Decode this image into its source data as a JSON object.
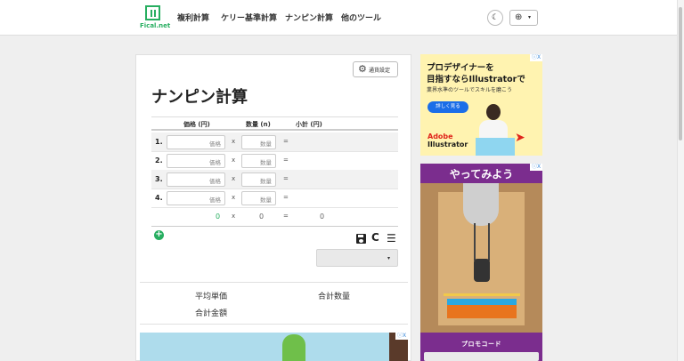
{
  "nav": {
    "logo_text": "Fical.net",
    "links": [
      "複利計算",
      "ケリー基準計算",
      "ナンピン計算",
      "他のツール"
    ],
    "theme_icon": "moon-icon",
    "lang_icon": "globe-icon",
    "lang_caret": "▾"
  },
  "card": {
    "settings_label": "通貨設定",
    "title": "ナンピン計算",
    "headers": {
      "price": "価格 (円)",
      "qty": "数量 (n)",
      "subtotal": "小計 (円)"
    },
    "rows": [
      {
        "num": "1.",
        "price_ph": "価格",
        "qty_ph": "数量",
        "x": "x",
        "eq": "="
      },
      {
        "num": "2.",
        "price_ph": "価格",
        "qty_ph": "数量",
        "x": "x",
        "eq": "="
      },
      {
        "num": "3.",
        "price_ph": "価格",
        "qty_ph": "数量",
        "x": "x",
        "eq": "="
      },
      {
        "num": "4.",
        "price_ph": "価格",
        "qty_ph": "数量",
        "x": "x",
        "eq": "="
      }
    ],
    "totals": {
      "price": "0",
      "x": "x",
      "qty": "0",
      "eq": "=",
      "subtotal": "0"
    },
    "add_icon": "+",
    "refresh_glyph": "C",
    "menu_glyph": "☰",
    "select_caret": "▾",
    "summary": {
      "avg_price": "平均単価",
      "total_qty": "合計数量",
      "total_amount": "合計金額"
    }
  },
  "ads": {
    "ad_choices": "ⓘX",
    "ad1": {
      "title_line1": "プロデザイナーを",
      "title_line2": "目指すならIllustratorで",
      "subtitle": "業界水準のツールでスキルを磨こう",
      "button": "詳しく見る",
      "brand_line1": "Adobe",
      "brand_line2": "Illustrator"
    },
    "ad2": {
      "title": "やってみよう",
      "promo": "プロモコード"
    }
  }
}
